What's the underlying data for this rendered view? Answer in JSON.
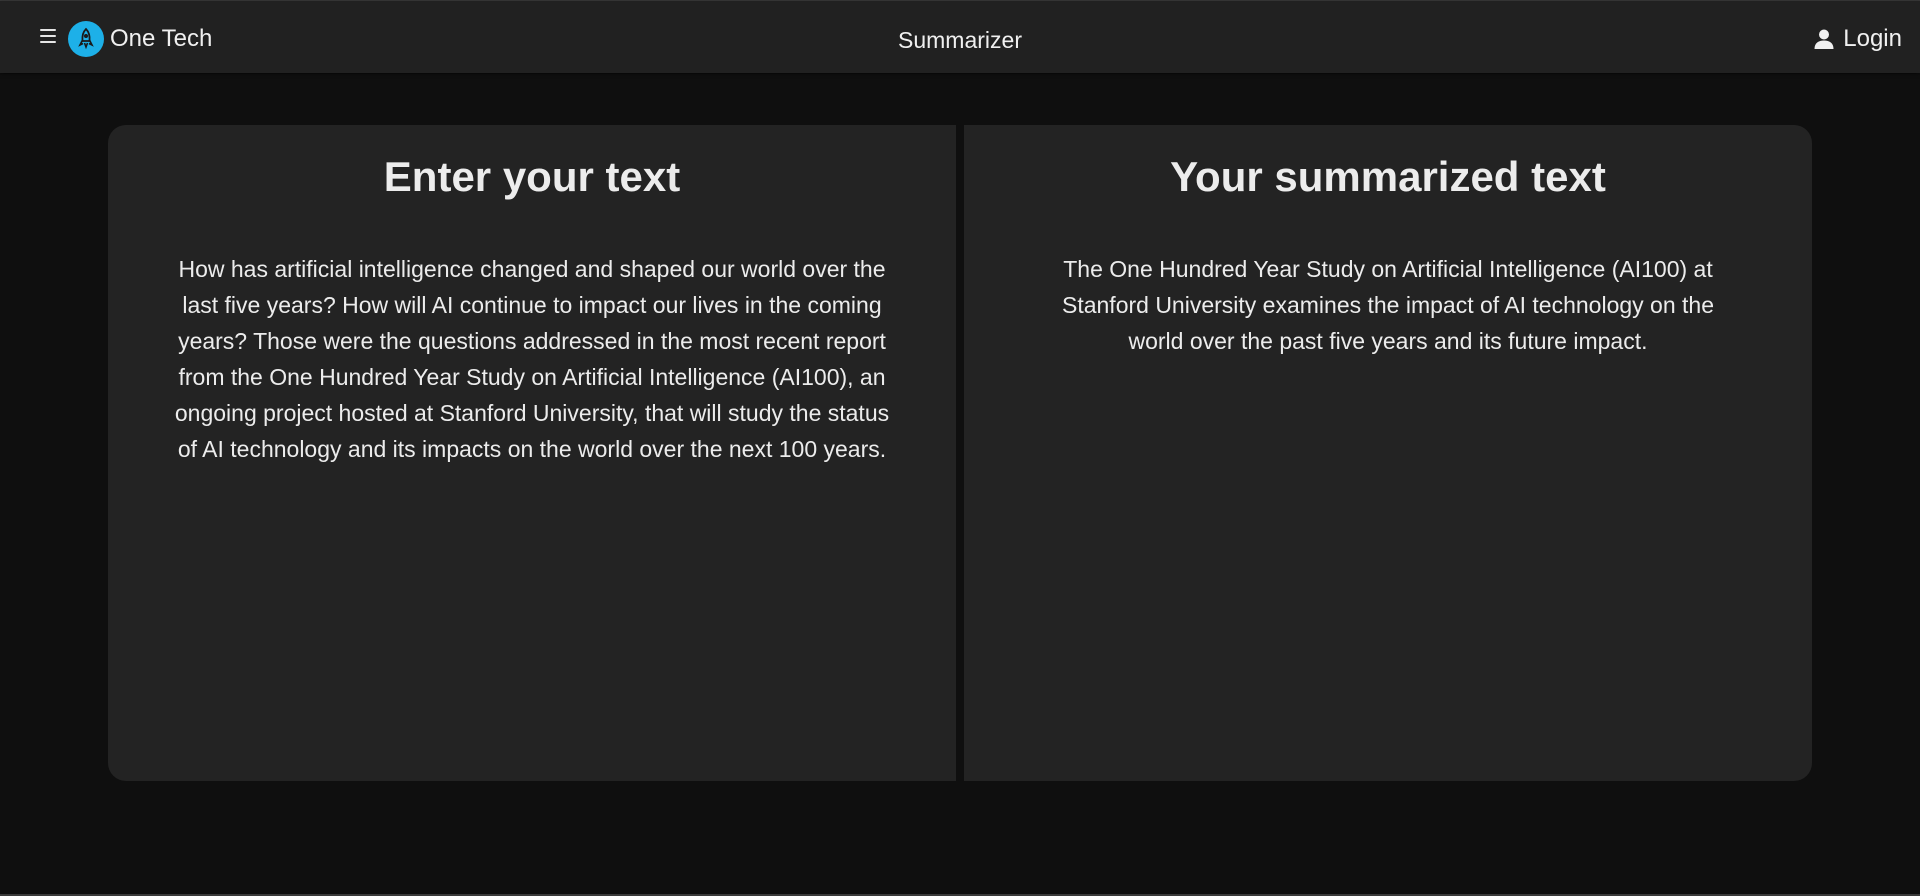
{
  "navbar": {
    "menu_icon": "hamburger-menu-icon",
    "logo_icon": "rocket-logo-icon",
    "brand": "One Tech",
    "title": "Summarizer",
    "login_icon": "user-icon",
    "login_label": "Login"
  },
  "input_panel": {
    "heading": "Enter your text",
    "text": "How has artificial intelligence changed and shaped our world over the last five years? How will AI continue to impact our lives in the coming years? Those were the questions addressed in the most recent report from the One Hundred Year Study on Artificial Intelligence (AI100), an ongoing project hosted at Stanford University, that will study the status of AI technology and its impacts on the world over the next 100 years."
  },
  "output_panel": {
    "heading": "Your summarized text",
    "text": "The One Hundred Year Study on Artificial Intelligence (AI100) at Stanford University examines the impact of AI technology on the world over the past five years and its future impact."
  },
  "colors": {
    "accent": "#1db0e8",
    "navbar_bg": "#212121",
    "page_bg": "#0f0f0f",
    "panel_bg": "#232323"
  }
}
